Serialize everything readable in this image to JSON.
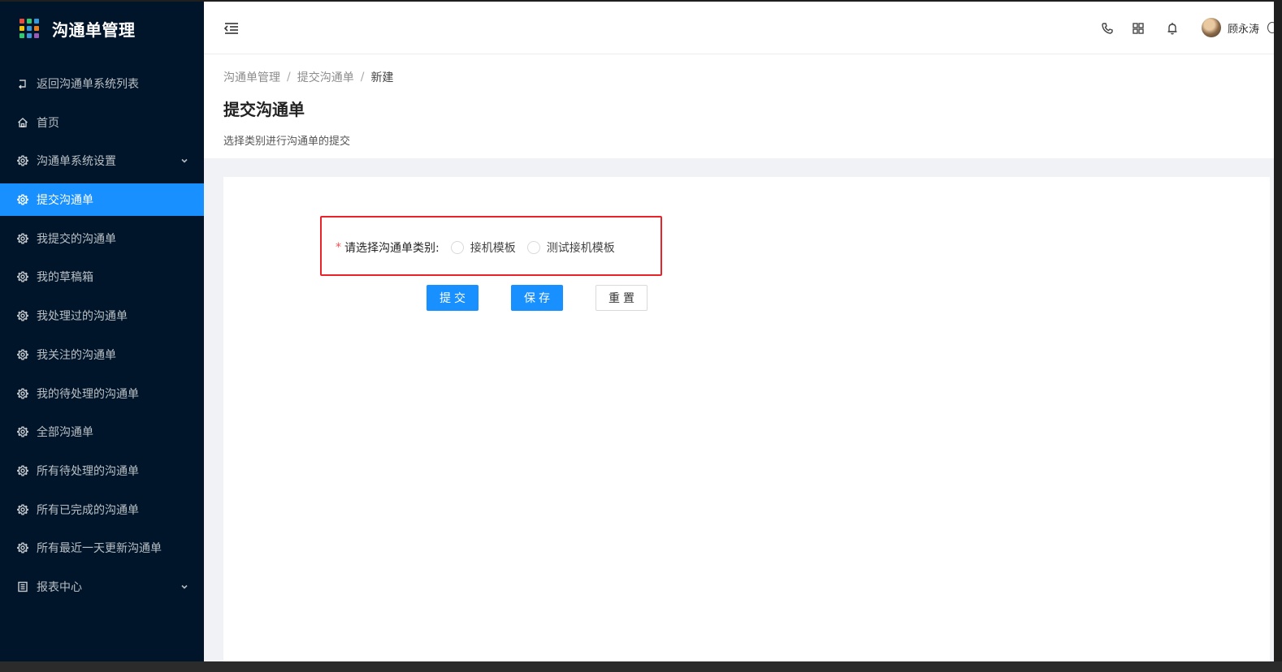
{
  "app": {
    "title": "沟通单管理",
    "logo_colors": [
      "#e74c3c",
      "#2ecc71",
      "#3498db",
      "#f1c40f",
      "#3498db",
      "#e67e22",
      "#2ecc71",
      "#3498db",
      "#9b59b6"
    ]
  },
  "sidebar": {
    "items": [
      {
        "label": "返回沟通单系统列表",
        "icon": "back-arrow-icon",
        "active": false,
        "expandable": false
      },
      {
        "label": "首页",
        "icon": "home-icon",
        "active": false,
        "expandable": false
      },
      {
        "label": "沟通单系统设置",
        "icon": "gear-icon",
        "active": false,
        "expandable": true
      },
      {
        "label": "提交沟通单",
        "icon": "gear-icon",
        "active": true,
        "expandable": false
      },
      {
        "label": "我提交的沟通单",
        "icon": "gear-icon",
        "active": false,
        "expandable": false
      },
      {
        "label": "我的草稿箱",
        "icon": "gear-icon",
        "active": false,
        "expandable": false
      },
      {
        "label": "我处理过的沟通单",
        "icon": "gear-icon",
        "active": false,
        "expandable": false
      },
      {
        "label": "我关注的沟通单",
        "icon": "gear-icon",
        "active": false,
        "expandable": false
      },
      {
        "label": "我的待处理的沟通单",
        "icon": "gear-icon",
        "active": false,
        "expandable": false
      },
      {
        "label": "全部沟通单",
        "icon": "gear-icon",
        "active": false,
        "expandable": false
      },
      {
        "label": "所有待处理的沟通单",
        "icon": "gear-icon",
        "active": false,
        "expandable": false
      },
      {
        "label": "所有已完成的沟通单",
        "icon": "gear-icon",
        "active": false,
        "expandable": false
      },
      {
        "label": "所有最近一天更新沟通单",
        "icon": "gear-icon",
        "active": false,
        "expandable": false
      },
      {
        "label": "报表中心",
        "icon": "report-icon",
        "active": false,
        "expandable": true
      }
    ],
    "active_color": "#1890ff"
  },
  "header": {
    "icons": [
      "phone-icon",
      "grid-icon",
      "bell-icon"
    ],
    "username": "顾永涛"
  },
  "breadcrumb": {
    "items": [
      "沟通单管理",
      "提交沟通单",
      "新建"
    ],
    "separator": "/"
  },
  "page": {
    "title": "提交沟通单",
    "description": "选择类别进行沟通单的提交"
  },
  "form": {
    "required_mark": "*",
    "label": "请选择沟通单类别:",
    "options": [
      "接机模板",
      "测试接机模板"
    ]
  },
  "buttons": {
    "submit": "提交",
    "save": "保存",
    "reset": "重置"
  }
}
